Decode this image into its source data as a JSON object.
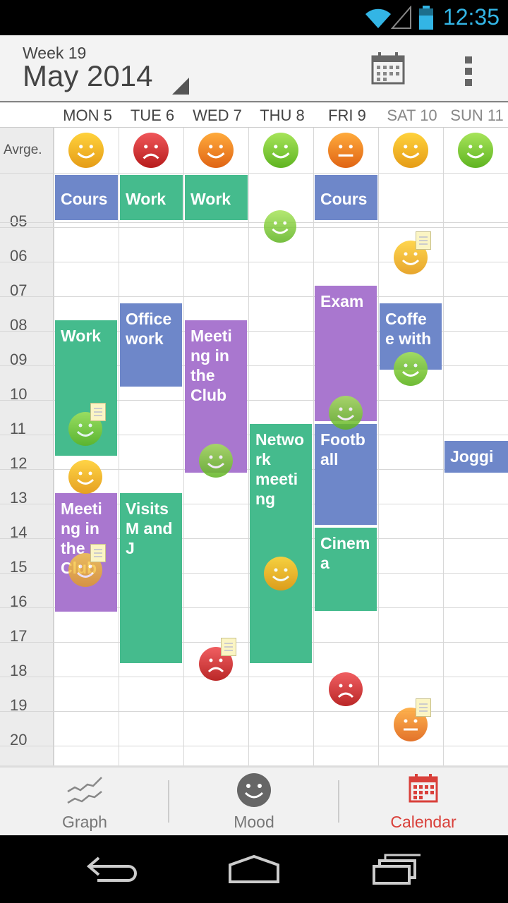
{
  "status_bar": {
    "time": "12:35",
    "icons": [
      "wifi-icon",
      "signal-icon",
      "battery-icon"
    ]
  },
  "header": {
    "week_label": "Week 19",
    "month_title": "May 2014",
    "actions": [
      "calendar-icon",
      "overflow-menu-icon"
    ]
  },
  "days": [
    {
      "label": "MON 5",
      "weekend": false
    },
    {
      "label": "TUE 6",
      "weekend": false
    },
    {
      "label": "WED 7",
      "weekend": false
    },
    {
      "label": "THU 8",
      "weekend": false
    },
    {
      "label": "FRI 9",
      "weekend": false
    },
    {
      "label": "SAT 10",
      "weekend": true
    },
    {
      "label": "SUN 11",
      "weekend": true
    }
  ],
  "average_label": "Avrge.",
  "average_moods": [
    "happy",
    "sad",
    "happy",
    "happy",
    "neutral",
    "happy",
    "happy"
  ],
  "hours": [
    "05",
    "06",
    "07",
    "08",
    "09",
    "10",
    "11",
    "12",
    "13",
    "14",
    "15",
    "16",
    "17",
    "18",
    "19",
    "20"
  ],
  "all_day_events": [
    {
      "day": 0,
      "title": "Cours",
      "color": "blue"
    },
    {
      "day": 1,
      "title": "Work",
      "color": "green"
    },
    {
      "day": 2,
      "title": "Work",
      "color": "green"
    },
    {
      "day": 4,
      "title": "Cours",
      "color": "blue"
    }
  ],
  "events": [
    {
      "day": 0,
      "title": "Work",
      "color": "green"
    },
    {
      "day": 0,
      "title": "Meeting in the Club",
      "color": "purple"
    },
    {
      "day": 1,
      "title": "Office work",
      "color": "blue"
    },
    {
      "day": 1,
      "title": "Visits M and J",
      "color": "green"
    },
    {
      "day": 2,
      "title": "Meeting in the Club",
      "color": "purple"
    },
    {
      "day": 3,
      "title": "Network meeting",
      "color": "green"
    },
    {
      "day": 4,
      "title": "Exam",
      "color": "purple"
    },
    {
      "day": 4,
      "title": "Football",
      "color": "blue"
    },
    {
      "day": 4,
      "title": "Cinema",
      "color": "green"
    },
    {
      "day": 5,
      "title": "Coffee with",
      "color": "blue"
    },
    {
      "day": 6,
      "title": "Jogging",
      "color": "blue"
    }
  ],
  "colors": {
    "blue": "#6e87c9",
    "green": "#45bb8d",
    "purple": "#a977cf",
    "accent": "#d9403a",
    "status_blue": "#33b5e5"
  },
  "bottom_nav": [
    {
      "label": "Graph",
      "icon": "graph-icon",
      "active": false
    },
    {
      "label": "Mood",
      "icon": "mood-icon",
      "active": false
    },
    {
      "label": "Calendar",
      "icon": "calendar-icon",
      "active": true
    }
  ],
  "system_nav": [
    "back-icon",
    "home-icon",
    "recents-icon"
  ]
}
